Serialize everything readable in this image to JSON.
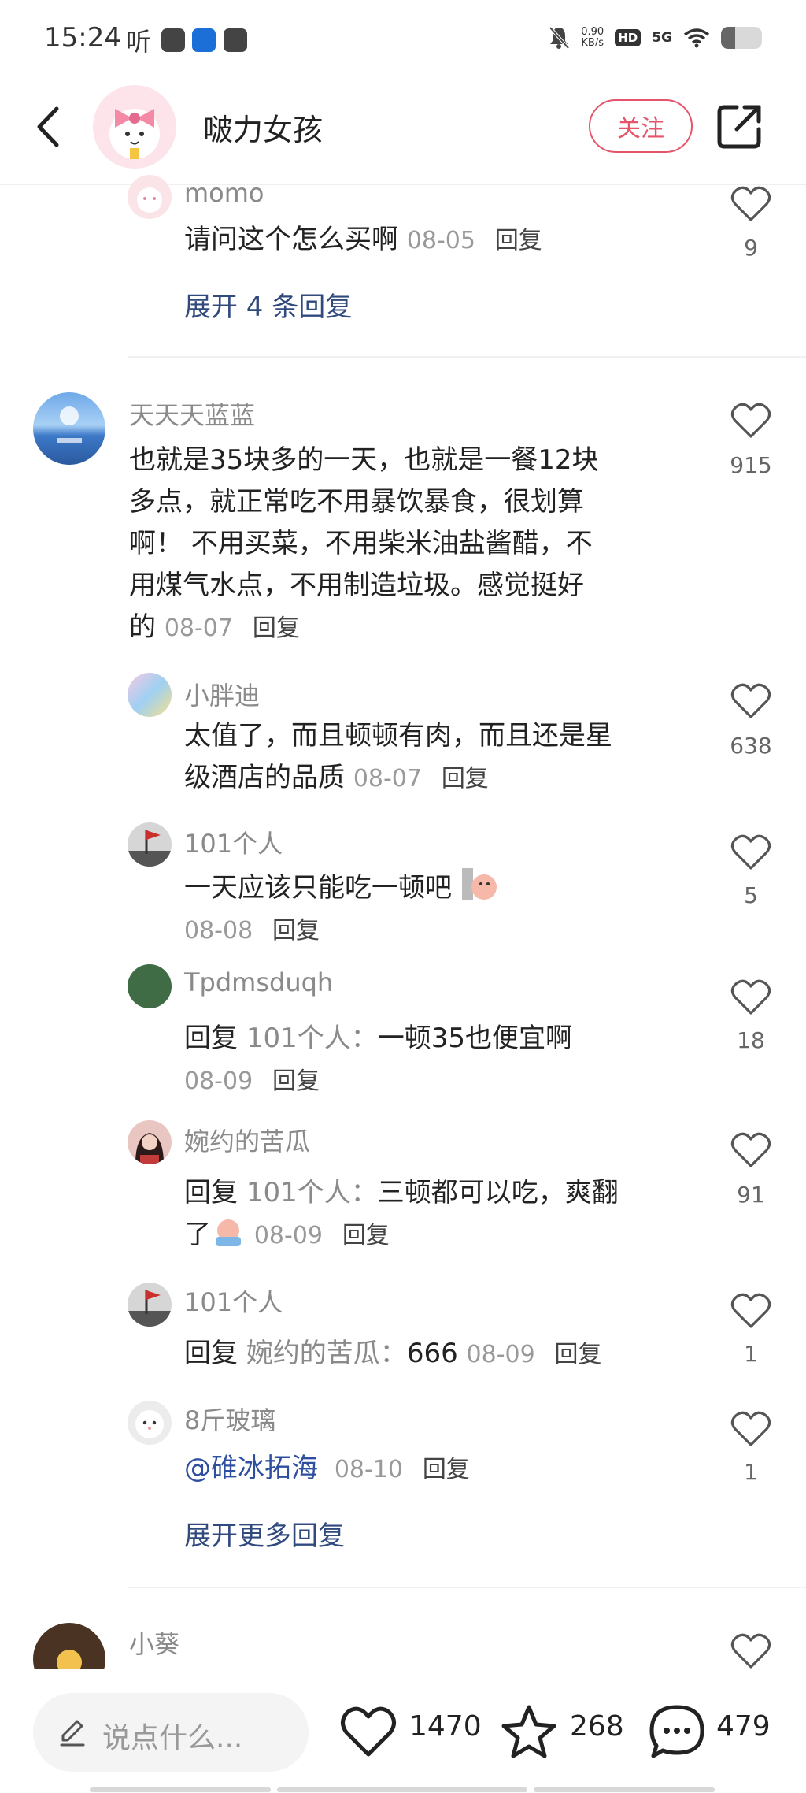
{
  "status_bar": {
    "time": "15:24",
    "ting": "听",
    "speed_value": "0.90",
    "speed_unit": "KB/s",
    "hd": "HD",
    "net": "5G",
    "battery_level": 0.35
  },
  "header": {
    "title": "啵力女孩",
    "follow_label": "关注"
  },
  "colors": {
    "accent": "#e5546a",
    "link": "#304a7e",
    "mention": "#2e4fa0"
  },
  "comments": [
    {
      "name": "momo",
      "text": "请问这个怎么买啊",
      "date": "08-05",
      "reply": "回复",
      "likes": "9",
      "expand": "展开 4 条回复"
    },
    {
      "name": "天天天蓝蓝",
      "lines": [
        "也就是35块多的一天，也就是一餐12块",
        "多点，就正常吃不用暴饮暴食，很划算",
        "啊！ 不用买菜，不用柴米油盐酱醋，不",
        "用煤气水点，不用制造垃圾。感觉挺好",
        "的"
      ],
      "date": "08-07",
      "reply": "回复",
      "likes": "915"
    },
    {
      "name": "小胖迪",
      "lines": [
        "太值了，而且顿顿有肉，而且还是星",
        "级酒店的品质"
      ],
      "date": "08-07",
      "reply": "回复",
      "likes": "638"
    },
    {
      "name": "101个人",
      "text": "一天应该只能吃一顿吧",
      "date": "08-08",
      "reply": "回复",
      "likes": "5"
    },
    {
      "name": "Tpdmsduqh",
      "prefix": "回复",
      "ref": "101个人：",
      "text": "一顿35也便宜啊",
      "date": "08-09",
      "reply": "回复",
      "likes": "18"
    },
    {
      "name": "婉约的苦瓜",
      "prefix": "回复",
      "ref": "101个人：",
      "text": "三顿都可以吃，爽翻",
      "text2": "了",
      "date": "08-09",
      "reply": "回复",
      "likes": "91"
    },
    {
      "name": "101个人",
      "prefix": "回复",
      "ref": "婉约的苦瓜：",
      "text": "666",
      "date": "08-09",
      "reply": "回复",
      "likes": "1"
    },
    {
      "name": "8斤玻璃",
      "mention": "@碓冰拓海",
      "date": "08-10",
      "reply": "回复",
      "likes": "1",
      "expand": "展开更多回复"
    },
    {
      "name": "小葵"
    }
  ],
  "bottom_bar": {
    "input_placeholder": "说点什么...",
    "likes": "1470",
    "favorites": "268",
    "comments": "479"
  },
  "icons": [
    "back-icon",
    "share-icon",
    "heart-icon",
    "star-icon",
    "comment-bubble-icon",
    "pen-icon",
    "mute-bell-icon",
    "wifi-icon"
  ]
}
